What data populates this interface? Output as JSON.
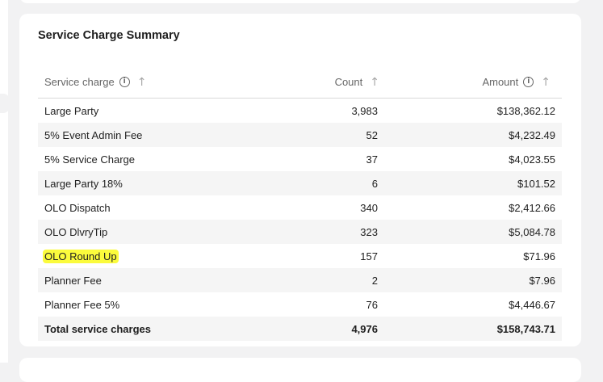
{
  "summary": {
    "title": "Service Charge Summary",
    "columns": {
      "service_charge": "Service charge",
      "count": "Count",
      "amount": "Amount"
    },
    "rows": [
      {
        "name": "Large Party",
        "count": "3,983",
        "amount": "$138,362.12"
      },
      {
        "name": "5% Event Admin Fee",
        "count": "52",
        "amount": "$4,232.49"
      },
      {
        "name": "5% Service Charge",
        "count": "37",
        "amount": "$4,023.55"
      },
      {
        "name": "Large Party 18%",
        "count": "6",
        "amount": "$101.52"
      },
      {
        "name": "OLO Dispatch",
        "count": "340",
        "amount": "$2,412.66"
      },
      {
        "name": "OLO DlvryTip",
        "count": "323",
        "amount": "$5,084.78"
      },
      {
        "name": "OLO Round Up",
        "count": "157",
        "amount": "$71.96"
      },
      {
        "name": "Planner Fee",
        "count": "2",
        "amount": "$7.96"
      },
      {
        "name": "Planner Fee 5%",
        "count": "76",
        "amount": "$4,446.67"
      }
    ],
    "total": {
      "name": "Total service charges",
      "count": "4,976",
      "amount": "$158,743.71"
    },
    "highlight_color": "#fbfb3c"
  }
}
